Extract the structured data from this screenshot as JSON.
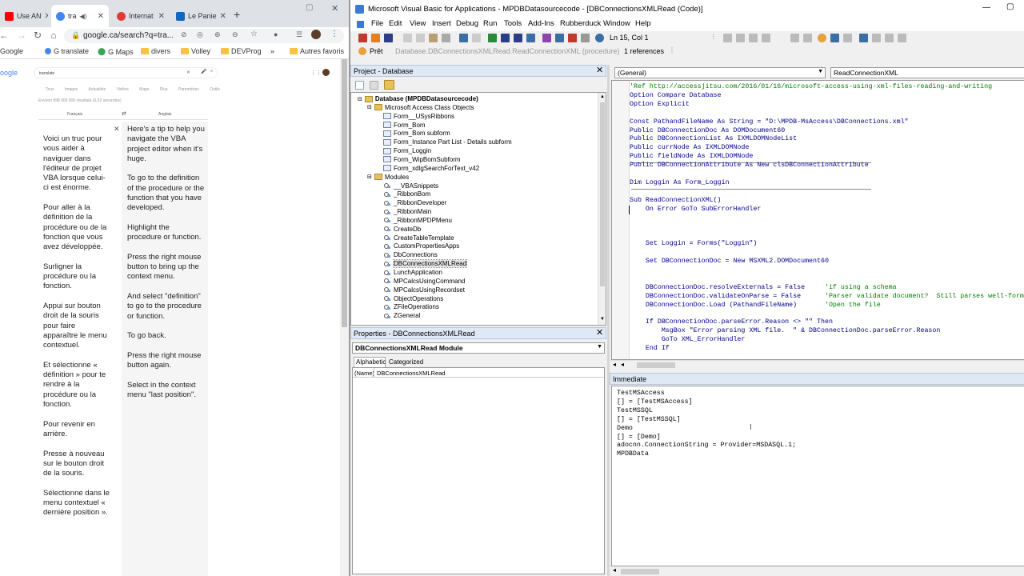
{
  "chrome": {
    "tabs": [
      {
        "label": "Use AN",
        "color": "#ff0000"
      },
      {
        "label": "tra",
        "color": "#4285f4",
        "active": true
      },
      {
        "label": "Internat",
        "color": "#e53935"
      },
      {
        "label": "Le Panie",
        "color": "#1565c0"
      }
    ],
    "new_tab": "+",
    "url": "google.ca/search?q=tra...",
    "bookmarks": [
      "Google",
      "G translate",
      "G Maps",
      "divers",
      "Volley",
      "DEVProg"
    ],
    "bookmarks_more": "»",
    "other_bookmarks": "Autres favoris",
    "google_logo": "oogle",
    "search_query": "translate",
    "search_tabs": [
      "Tous",
      "Images",
      "Actualités",
      "Vidéos",
      "Maps",
      "Plus",
      "Paramètres",
      "Outils"
    ],
    "result_count": "Environ 998 000 000 résultats (0,52 secondes)",
    "source_lang": "Français",
    "swap": "⇄",
    "target_lang": "Anglais",
    "french_paragraphs": [
      "Voici un truc pour vous aider à naviguer dans l'éditeur de projet VBA lorsque celui-ci est énorme.",
      "Pour aller à la définition de la procédure ou de la fonction que vous avez développée.",
      "Surligner la procédure ou la fonction.",
      "Appui sur bouton droit de la souris pour faire apparaître le menu contextuel.",
      "Et sélectionne « définition » pour te rendre à la procédure ou la fonction.",
      "Pour revenir en arrière.",
      "Presse à nouveau sur le bouton droit de la souris.",
      "Sélectionne dans le menu contextuel « dernière position »."
    ],
    "english_paragraphs": [
      "Here's a tip to help you navigate the VBA project editor when it's huge.",
      "To go to the definition of the procedure or the function that you have developed.",
      "Highlight the procedure or function.",
      "Press the right mouse button to bring up the context menu.",
      "And select \"definition\" to go to the procedure or function.",
      "To go back.",
      "Press the right mouse button again.",
      "Select in the context menu \"last position\"."
    ]
  },
  "vba": {
    "title": "Microsoft Visual Basic for Applications - MPDBDatasourcecode - [DBConnectionsXMLRead (Code)]",
    "menus": [
      "File",
      "Edit",
      "View",
      "Insert",
      "Debug",
      "Run",
      "Tools",
      "Add-Ins",
      "Rubberduck",
      "Window",
      "Help"
    ],
    "position": "Ln 15, Col 1",
    "status_ready": "Prêt",
    "breadcrumb": "Database.DBConnectionsXMLRead.ReadConnectionXML (procedure)",
    "references": "1 references",
    "project_title": "Project - Database",
    "tree": [
      {
        "label": "Database (MPDBDatasourcecode)",
        "level": 0,
        "type": "root"
      },
      {
        "label": "Microsoft Access Class Objects",
        "level": 1,
        "type": "folder"
      },
      {
        "label": "Form__USysRibbons",
        "level": 2,
        "type": "form"
      },
      {
        "label": "Form_Bom",
        "level": 2,
        "type": "form"
      },
      {
        "label": "Form_Bom subform",
        "level": 2,
        "type": "form"
      },
      {
        "label": "Form_Instance Part List - Details subform",
        "level": 2,
        "type": "form"
      },
      {
        "label": "Form_Loggin",
        "level": 2,
        "type": "form"
      },
      {
        "label": "Form_WipBomSubform",
        "level": 2,
        "type": "form"
      },
      {
        "label": "Form_xdlgSearchForText_v42",
        "level": 2,
        "type": "form"
      },
      {
        "label": "Modules",
        "level": 1,
        "type": "folder"
      },
      {
        "label": "__VBASnippets",
        "level": 2,
        "type": "module"
      },
      {
        "label": "_RibbonBom",
        "level": 2,
        "type": "module"
      },
      {
        "label": "_RibbonDeveloper",
        "level": 2,
        "type": "module"
      },
      {
        "label": "_RibbonMain",
        "level": 2,
        "type": "module"
      },
      {
        "label": "_RibbonMPDPMenu",
        "level": 2,
        "type": "module"
      },
      {
        "label": "CreateDb",
        "level": 2,
        "type": "module"
      },
      {
        "label": "CreateTableTemplate",
        "level": 2,
        "type": "module"
      },
      {
        "label": "CustomPropertiesApps",
        "level": 2,
        "type": "module"
      },
      {
        "label": "DbConnections",
        "level": 2,
        "type": "module"
      },
      {
        "label": "DBConnectionsXMLRead",
        "level": 2,
        "type": "module"
      },
      {
        "label": "LunchApplication",
        "level": 2,
        "type": "module"
      },
      {
        "label": "MPCalcsUsingCommand",
        "level": 2,
        "type": "module"
      },
      {
        "label": "MPCalcsUsingRecordset",
        "level": 2,
        "type": "module"
      },
      {
        "label": "ObjectOperations",
        "level": 2,
        "type": "module"
      },
      {
        "label": "ZFileOperations",
        "level": 2,
        "type": "module"
      },
      {
        "label": "ZGeneral",
        "level": 2,
        "type": "module"
      }
    ],
    "properties_title": "Properties - DBConnectionsXMLRead",
    "properties_object": "DBConnectionsXMLRead Module",
    "properties_tabs": [
      "Alphabetic",
      "Categorized"
    ],
    "properties_row": {
      "name": "(Name)",
      "value": "DBConnectionsXMLRead"
    },
    "object_dropdown": "(General)",
    "proc_dropdown": "ReadConnectionXML",
    "code_lines": [
      {
        "t": "'Ref http://accessjitsu.com/2016/01/16/microsoft-access-using-xml-files-reading-and-writing",
        "c": "cm"
      },
      {
        "t": "Option Compare Database",
        "c": "kw"
      },
      {
        "t": "Option Explicit",
        "c": "kw"
      },
      {
        "t": "",
        "c": ""
      },
      {
        "t": "Const PathandFileName As String = \"D:\\MPDB-MsAccess\\DBConnections.xml\"",
        "c": "kw"
      },
      {
        "t": "Public DBConnectionDoc As DOMDocument60",
        "c": "kw"
      },
      {
        "t": "Public DBConnectionList As IXMLDOMNodeList",
        "c": "kw"
      },
      {
        "t": "Public currNode As IXMLDOMNode",
        "c": "kw"
      },
      {
        "t": "Public fieldNode As IXMLDOMNode",
        "c": "kw"
      },
      {
        "t": "Public DBConnectionAttribute As New clsDBConnectionAttribute",
        "c": "kw"
      },
      {
        "t": "",
        "c": ""
      },
      {
        "t": "Dim Loggin As Form_Loggin",
        "c": "kw"
      },
      {
        "t": "",
        "c": ""
      },
      {
        "t": "Sub ReadConnectionXML()",
        "c": "kw"
      },
      {
        "t": "    On Error GoTo SubErrorHandler",
        "c": "kw"
      },
      {
        "t": "",
        "c": ""
      },
      {
        "t": "",
        "c": ""
      },
      {
        "t": "",
        "c": ""
      },
      {
        "t": "    Set Loggin = Forms(\"Loggin\")",
        "c": "kw"
      },
      {
        "t": "",
        "c": ""
      },
      {
        "t": "    Set DBConnectionDoc = New MSXML2.DOMDocument60",
        "c": "kw"
      },
      {
        "t": "",
        "c": ""
      },
      {
        "t": "",
        "c": ""
      },
      {
        "t": "    DBConnectionDoc.resolveExternals = False     ",
        "c": "kw",
        "cmt": "'if using a schema"
      },
      {
        "t": "    DBConnectionDoc.validateOnParse = False      ",
        "c": "kw",
        "cmt": "'Parser validate document?  Still parses well-formed XML"
      },
      {
        "t": "    DBConnectionDoc.Load (PathandFileName)       ",
        "c": "kw",
        "cmt": "'Open the file"
      },
      {
        "t": "",
        "c": ""
      },
      {
        "t": "    If DBConnectionDoc.parseError.Reason <> \"\" Then",
        "c": "kw"
      },
      {
        "t": "        MsgBox \"Error parsing XML file.  \" & DBConnectionDoc.parseError.Reason",
        "c": "kw"
      },
      {
        "t": "        GoTo XML_ErrorHandler",
        "c": "kw"
      },
      {
        "t": "    End If",
        "c": "kw"
      }
    ],
    "immediate_title": "Immediate",
    "immediate_lines": [
      "TestMSAccess",
      "[] = [TestMSAccess]",
      "TestMSSQL",
      "[] = [TestMSSQL]",
      "Demo",
      "[] = [Demo]",
      "adocnn.ConnectionString = Provider=MSDASQL.1;",
      "MPDBData"
    ]
  }
}
